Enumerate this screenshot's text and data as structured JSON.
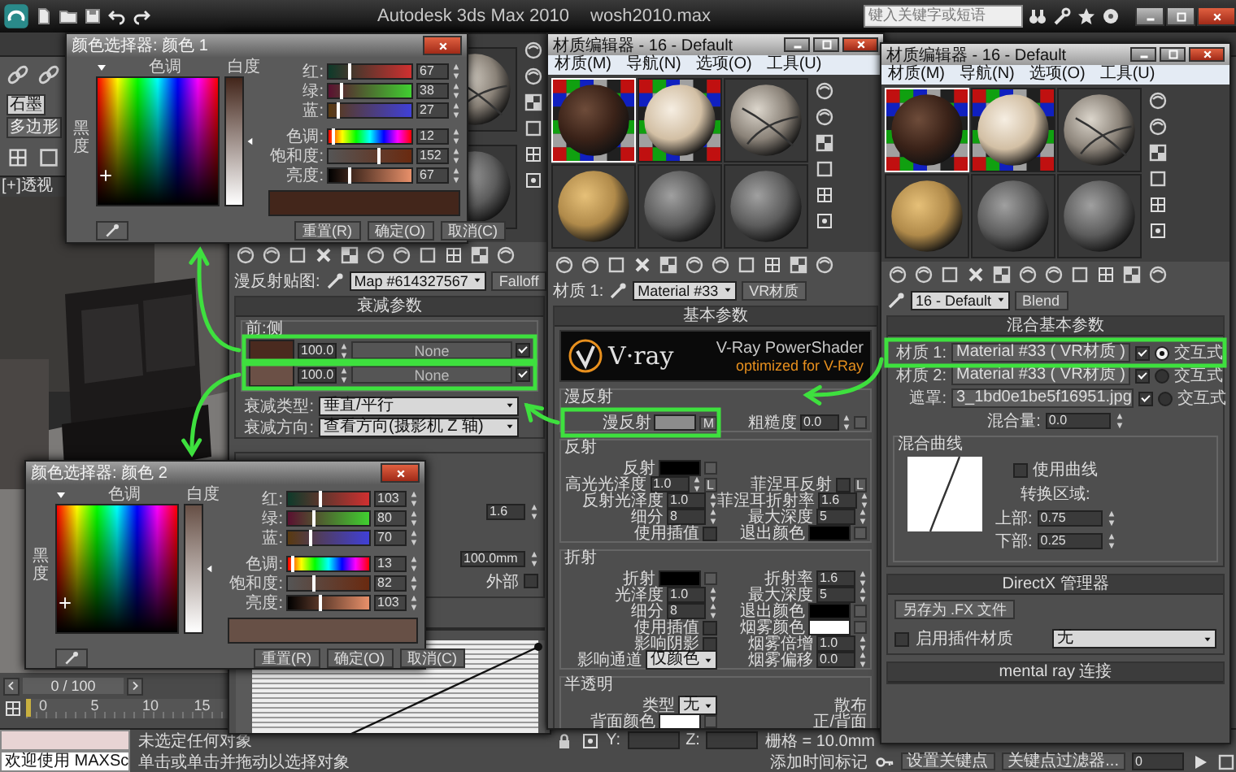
{
  "app": {
    "title": "Autodesk 3ds Max 2010",
    "file": "wosh2010.max",
    "search_placeholder": "键入关键字或短语"
  },
  "command_tabs": [
    {
      "label": "石墨",
      "selected": true
    },
    {
      "label": "多边形",
      "selected": false
    }
  ],
  "viewport": {
    "label": "[ + ] 透视"
  },
  "timeline": {
    "position": "0 / 100",
    "ticks": [
      "0",
      "5",
      "10",
      "15"
    ]
  },
  "status_bar": {
    "welcome": "欢迎使用 MAXSc",
    "prompt": "未选定任何对象",
    "hint": "单击或单击并拖动以选择对象",
    "coord_labels": [
      "Y:",
      "Z:"
    ],
    "grid": "栅格 = 10.0mm",
    "time_tag": "添加时间标记",
    "set_key": "设置关键点",
    "key_filter": "关键点过滤器...",
    "frame": "0"
  },
  "falloff_editor": {
    "spheres": [
      {
        "kind": "stone",
        "selected": false
      },
      {
        "kind": "grey",
        "selected": false
      }
    ],
    "map_label": "漫反射贴图:",
    "map_name": "Map #614327567",
    "map_type": "Falloff",
    "rollout": "衰减参数",
    "group": "前:侧",
    "slots": [
      {
        "amount": "100.0",
        "map": "None",
        "enabled": true,
        "color": "#4a2a1f"
      },
      {
        "amount": "100.0",
        "map": "None",
        "enabled": true,
        "color": "#6b5046"
      }
    ],
    "options": [
      {
        "label": "衰减类型:",
        "value": "垂直/平行"
      },
      {
        "label": "衰减方向:",
        "value": "查看方向(摄影机 Z 轴)"
      }
    ],
    "fields": [
      "1.6",
      "100.0mm"
    ],
    "outside": {
      "label": "外部",
      "checked": false
    }
  },
  "vray_editor": {
    "title": "材质编辑器 - 16 - Default",
    "menus": [
      "材质(M)",
      "导航(N)",
      "选项(O)",
      "工具(U)"
    ],
    "spheres": [
      {
        "kind": "dark-wood",
        "selected": true
      },
      {
        "kind": "cream",
        "selected": false
      },
      {
        "kind": "stone",
        "selected": false
      },
      {
        "kind": "tan",
        "selected": false
      },
      {
        "kind": "grey",
        "selected": false
      },
      {
        "kind": "grey",
        "selected": false
      }
    ],
    "material_label": "材质 1:",
    "material_name": "Material #33",
    "material_type": "VR材质",
    "rollout": "基本参数",
    "banner": {
      "logo": "V·ray",
      "title": "V-Ray PowerShader",
      "subtitle": "optimized for V-Ray"
    },
    "diffuse": {
      "group": "漫反射",
      "label": "漫反射",
      "color": "#8c8c8c",
      "map_button": "M",
      "roughness_label": "粗糙度",
      "roughness": "0.0"
    },
    "groups": [
      {
        "label": "反射",
        "rows": [
          [
            {
              "kind": "swatch",
              "label": "反射",
              "color": "#000000"
            }
          ],
          [
            {
              "kind": "spinner",
              "label": "高光光泽度",
              "value": "1.0",
              "lock": "L"
            },
            {
              "kind": "check",
              "label": "菲涅耳反射",
              "checked": false,
              "lock": "L"
            }
          ],
          [
            {
              "kind": "spinner",
              "label": "反射光泽度",
              "value": "1.0"
            },
            {
              "kind": "spinner",
              "label": "菲涅耳折射率",
              "value": "1.6"
            }
          ],
          [
            {
              "kind": "spinner",
              "label": "细分",
              "value": "8"
            },
            {
              "kind": "spinner",
              "label": "最大深度",
              "value": "5"
            }
          ],
          [
            {
              "kind": "check",
              "label": "使用插值",
              "checked": false
            },
            {
              "kind": "swatch",
              "label": "退出颜色",
              "color": "#000000"
            }
          ]
        ]
      },
      {
        "label": "折射",
        "rows": [
          [
            {
              "kind": "swatch",
              "label": "折射",
              "color": "#000000"
            },
            {
              "kind": "spinner",
              "label": "折射率",
              "value": "1.6"
            }
          ],
          [
            {
              "kind": "spinner",
              "label": "光泽度",
              "value": "1.0"
            },
            {
              "kind": "spinner",
              "label": "最大深度",
              "value": "5"
            }
          ],
          [
            {
              "kind": "spinner",
              "label": "细分",
              "value": "8"
            },
            {
              "kind": "swatch",
              "label": "退出颜色",
              "color": "#000000"
            }
          ],
          [
            {
              "kind": "check",
              "label": "使用插值",
              "checked": false
            },
            {
              "kind": "swatch",
              "label": "烟雾颜色",
              "color": "#ffffff"
            }
          ],
          [
            {
              "kind": "check",
              "label": "影响阴影",
              "checked": false
            },
            {
              "kind": "spinner",
              "label": "烟雾倍增",
              "value": "1.0"
            }
          ],
          [
            {
              "kind": "dropdown",
              "label": "影响通道",
              "value": "仅颜色"
            },
            {
              "kind": "spinner",
              "label": "烟雾偏移",
              "value": "0.0"
            }
          ]
        ]
      },
      {
        "label": "半透明",
        "rows": [
          [
            {
              "kind": "dropdown",
              "label": "类型",
              "value": "无"
            },
            {
              "kind": "text",
              "label": "散布"
            }
          ],
          [
            {
              "kind": "swatch",
              "label": "背面颜色",
              "color": "#ffffff"
            },
            {
              "kind": "text",
              "label": "正/背面"
            }
          ]
        ]
      }
    ]
  },
  "blend_editor": {
    "title": "材质编辑器 - 16 - Default",
    "menus": [
      "材质(M)",
      "导航(N)",
      "选项(O)",
      "工具(U)"
    ],
    "spheres": [
      {
        "kind": "dark-wood",
        "selected": true
      },
      {
        "kind": "cream",
        "selected": false
      },
      {
        "kind": "stone",
        "selected": false
      },
      {
        "kind": "tan",
        "selected": false
      },
      {
        "kind": "grey",
        "selected": false
      },
      {
        "kind": "grey",
        "selected": false
      }
    ],
    "material_name": "16 - Default",
    "material_type": "Blend",
    "rollout": "混合基本参数",
    "slots": [
      {
        "label": "材质 1:",
        "value": "Material #33 ( VR材质 )",
        "enabled": true,
        "selected": true,
        "option": "交互式"
      },
      {
        "label": "材质 2:",
        "value": "Material #33 ( VR材质 )",
        "enabled": true,
        "selected": false,
        "option": "交互式"
      },
      {
        "label": "遮罩:",
        "value": "3_1bd0e1be5f16951.jpg",
        "enabled": true,
        "selected": false,
        "option": "交互式"
      }
    ],
    "mix_label": "混合量:",
    "mix": "0.0",
    "curve_group": "混合曲线",
    "use_curve": {
      "label": "使用曲线",
      "checked": false
    },
    "transition_label": "转换区域:",
    "upper": {
      "label": "上部:",
      "value": "0.75"
    },
    "lower": {
      "label": "下部:",
      "value": "0.25"
    },
    "directx": {
      "rollout": "DirectX 管理器",
      "save_button": "另存为 .FX 文件",
      "plugin": {
        "label": "启用插件材质",
        "checked": false
      },
      "dropdown": "无"
    },
    "mental_ray": "mental ray 连接"
  },
  "color_pickers": [
    {
      "title": "颜色选择器: 颜色 1",
      "hue_label": "色调",
      "white_label": "白度",
      "black_label": "黑度",
      "color": "#43261b",
      "sliders": [
        {
          "kind": "red",
          "label": "红:",
          "value": "67",
          "level": 0.26
        },
        {
          "kind": "green",
          "label": "绿:",
          "value": "38",
          "level": 0.15
        },
        {
          "kind": "blue",
          "label": "蓝:",
          "value": "27",
          "level": 0.11
        },
        {
          "kind": "hue",
          "label": "色调:",
          "value": "12",
          "level": 0.05
        },
        {
          "kind": "sat",
          "label": "饱和度:",
          "value": "152",
          "level": 0.6
        },
        {
          "kind": "value",
          "label": "亮度:",
          "value": "67",
          "level": 0.26
        }
      ],
      "reset": "重置(R)",
      "ok": "确定(O)",
      "cancel": "取消(C)"
    },
    {
      "title": "颜色选择器: 颜色 2",
      "hue_label": "色调",
      "white_label": "白度",
      "black_label": "黑度",
      "color": "#675046",
      "sliders": [
        {
          "kind": "red",
          "label": "红:",
          "value": "103",
          "level": 0.4
        },
        {
          "kind": "green",
          "label": "绿:",
          "value": "80",
          "level": 0.31
        },
        {
          "kind": "blue",
          "label": "蓝:",
          "value": "70",
          "level": 0.27
        },
        {
          "kind": "hue",
          "label": "色调:",
          "value": "13",
          "level": 0.05
        },
        {
          "kind": "sat",
          "label": "饱和度:",
          "value": "82",
          "level": 0.32
        },
        {
          "kind": "value",
          "label": "亮度:",
          "value": "103",
          "level": 0.4
        }
      ],
      "reset": "重置(R)",
      "ok": "确定(O)",
      "cancel": "取消(C)"
    }
  ]
}
